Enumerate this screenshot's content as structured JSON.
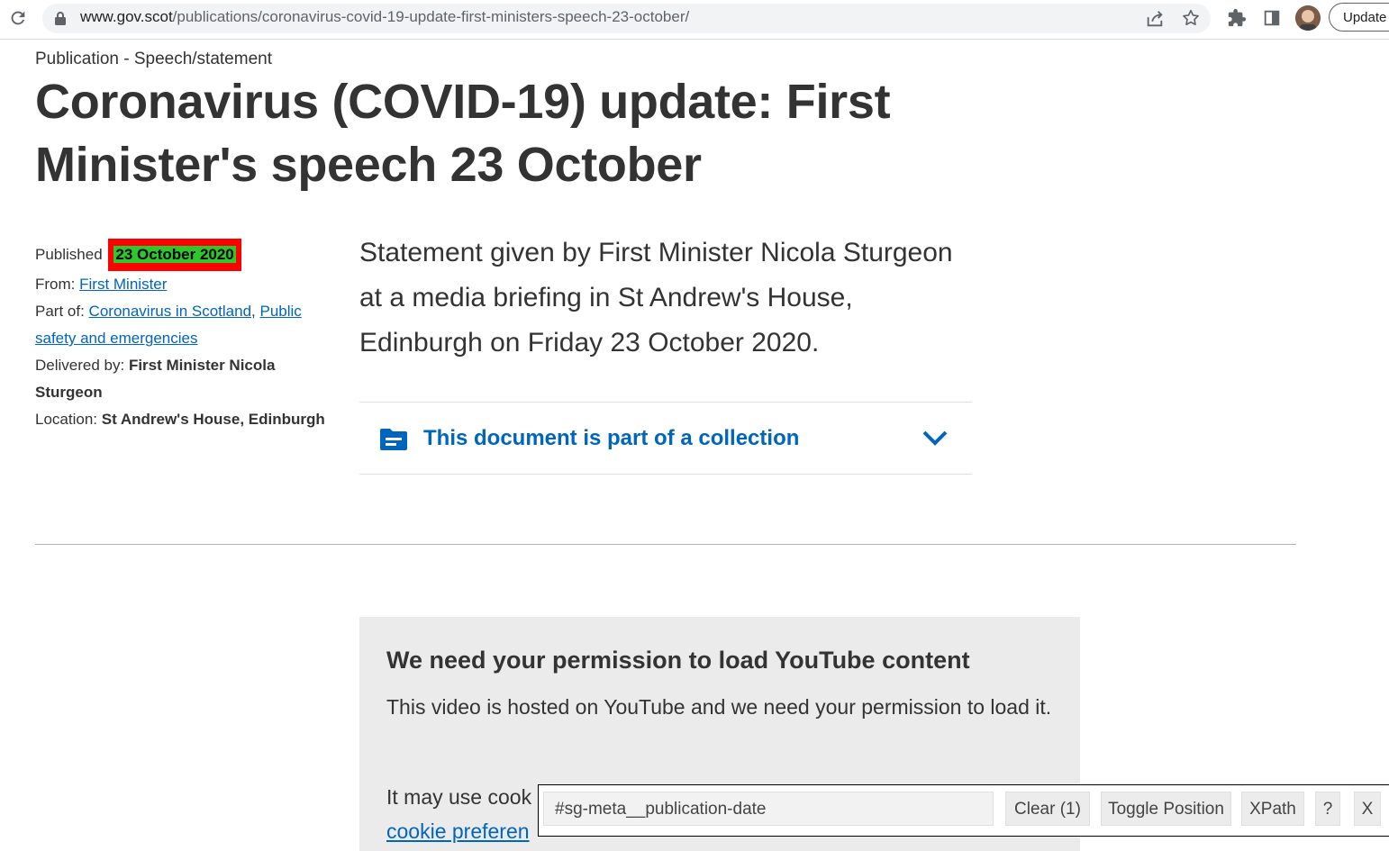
{
  "browser": {
    "url_host": "www.gov.scot",
    "url_path": "/publications/coronavirus-covid-19-update-first-ministers-speech-23-october/",
    "update_label": "Update"
  },
  "page": {
    "label": "Publication - Speech/statement",
    "title": "Coronavirus (COVID-19) update: First Minister's speech 23 October",
    "meta": {
      "published_label": "Published",
      "published_date": "23 October 2020",
      "from_label": "From:",
      "from_link": "First Minister",
      "part_of_label": "Part of:",
      "part_of_link1": "Coronavirus in Scotland",
      "part_of_sep": ",",
      "part_of_link2": "Public safety and emergencies",
      "delivered_label": "Delivered by:",
      "delivered_value": "First Minister Nicola Sturgeon",
      "location_label": "Location:",
      "location_value": "St Andrew's House, Edinburgh"
    },
    "summary": "Statement given by First Minister Nicola Sturgeon at a media briefing in St Andrew's House, Edinburgh on Friday 23 October 2020.",
    "collection_label": "This document is part of a collection",
    "youtube": {
      "title": "We need your permission to load YouTube content",
      "text": "This video is hosted on YouTube and we need your permission to load it.",
      "cookie_text": "It may use cook",
      "cookie_link": "cookie preferen"
    }
  },
  "helper": {
    "selector_value": "#sg-meta__publication-date",
    "clear_label": "Clear (1)",
    "toggle_label": "Toggle Position",
    "xpath_label": "XPath",
    "help_label": "?",
    "close_label": "X"
  },
  "colors": {
    "link": "#0065bd",
    "highlight_box": "#ff0000",
    "highlight_text_bg": "#2cc82c",
    "video_panel_bg": "#ebebeb"
  }
}
